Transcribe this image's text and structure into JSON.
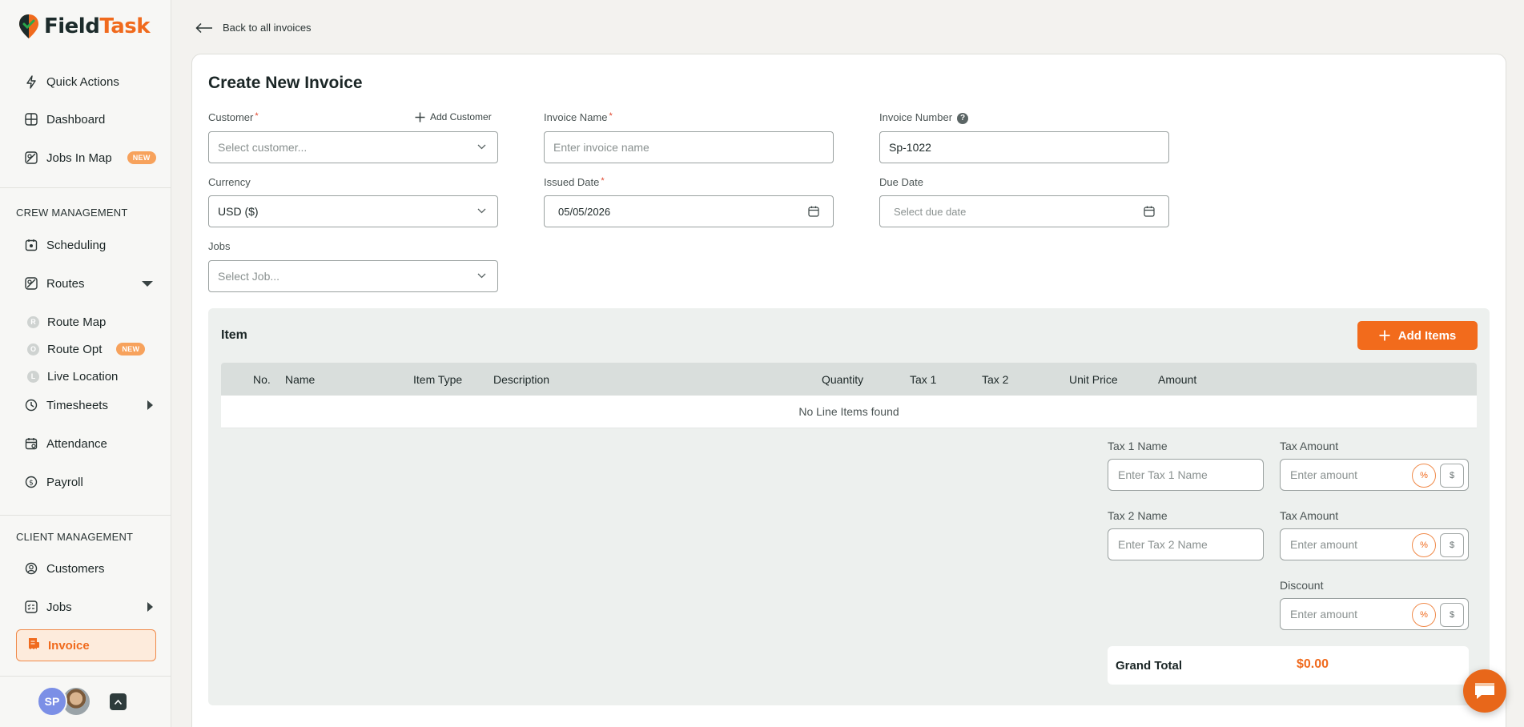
{
  "app": {
    "logo_part1": "Field",
    "logo_part2": "Task"
  },
  "sidebar": {
    "top_items": [
      {
        "label": "Quick Actions",
        "icon": "lightning-icon"
      },
      {
        "label": "Dashboard",
        "icon": "dashboard-icon"
      },
      {
        "label": "Jobs In Map",
        "icon": "map-icon",
        "badge": "NEW"
      }
    ],
    "crew_section": "CREW MANAGEMENT",
    "crew_items": [
      {
        "label": "Scheduling",
        "icon": "calendar-icon"
      },
      {
        "label": "Routes",
        "icon": "route-icon"
      },
      {
        "label": "Route Map",
        "icon": "route-map-icon",
        "letter": "R"
      },
      {
        "label": "Route Opt",
        "icon": "route-opt-icon",
        "letter": "O",
        "badge": "NEW"
      },
      {
        "label": "Live Location",
        "icon": "live-location-icon",
        "letter": "L"
      },
      {
        "label": "Timesheets",
        "icon": "clock-icon"
      },
      {
        "label": "Attendance",
        "icon": "attendance-icon"
      },
      {
        "label": "Payroll",
        "icon": "payroll-icon"
      }
    ],
    "client_section": "CLIENT MANAGEMENT",
    "client_items": [
      {
        "label": "Customers",
        "icon": "customers-icon"
      },
      {
        "label": "Jobs",
        "icon": "jobs-icon"
      },
      {
        "label": "Invoice",
        "icon": "invoice-icon"
      }
    ],
    "user_initials": "SP"
  },
  "page": {
    "back_label": "Back to all invoices",
    "title": "Create New Invoice"
  },
  "form": {
    "customer": {
      "label": "Customer",
      "required": "*",
      "placeholder": "Select customer...",
      "add_label": "Add Customer"
    },
    "invoice_name": {
      "label": "Invoice Name",
      "required": "*",
      "placeholder": "Enter invoice name"
    },
    "invoice_number": {
      "label": "Invoice Number",
      "help": "?",
      "value": "Sp-1022"
    },
    "currency": {
      "label": "Currency",
      "value": "USD ($)"
    },
    "issued_date": {
      "label": "Issued Date",
      "required": "*",
      "value": "05/05/2026"
    },
    "due_date": {
      "label": "Due Date",
      "placeholder": "Select due date"
    },
    "jobs": {
      "label": "Jobs",
      "placeholder": "Select Job..."
    }
  },
  "items": {
    "title": "Item",
    "add_button": "Add Items",
    "columns": [
      "No.",
      "Name",
      "Item Type",
      "Description",
      "Quantity",
      "Tax 1",
      "Tax 2",
      "Unit Price",
      "Amount"
    ],
    "empty_text": "No Line Items found"
  },
  "totals": {
    "tax1_name_label": "Tax 1 Name",
    "tax1_name_placeholder": "Enter Tax 1 Name",
    "tax1_amount_label": "Tax Amount",
    "tax2_name_label": "Tax 2 Name",
    "tax2_name_placeholder": "Enter Tax 2 Name",
    "tax2_amount_label": "Tax Amount",
    "discount_label": "Discount",
    "amount_placeholder": "Enter amount",
    "percent_symbol": "%",
    "dollar_symbol": "$",
    "grand_total_label": "Grand Total",
    "grand_total_value": "$0.00"
  },
  "colors": {
    "accent": "#f06a1d",
    "badge": "#f7a25c",
    "panel": "#edf0ee"
  }
}
